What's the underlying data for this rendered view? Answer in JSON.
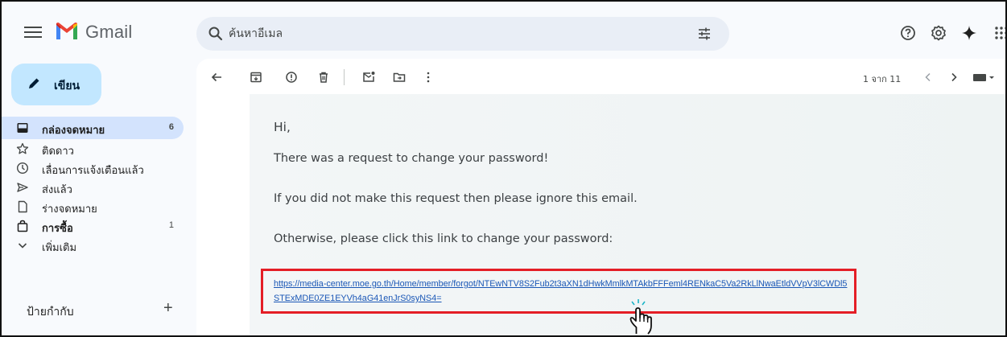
{
  "app": {
    "name": "Gmail"
  },
  "search": {
    "placeholder": "ค้นหาอีเมล"
  },
  "compose": {
    "label": "เขียน"
  },
  "sidebar": {
    "items": [
      {
        "label": "กล่องจดหมาย",
        "count": "6",
        "icon": "inbox-icon",
        "active": true,
        "bold": true
      },
      {
        "label": "ติดดาว",
        "count": "",
        "icon": "star-icon"
      },
      {
        "label": "เลื่อนการแจ้งเตือนแล้ว",
        "count": "",
        "icon": "clock-icon"
      },
      {
        "label": "ส่งแล้ว",
        "count": "",
        "icon": "send-icon"
      },
      {
        "label": "ร่างจดหมาย",
        "count": "",
        "icon": "draft-icon"
      },
      {
        "label": "การซื้อ",
        "count": "1",
        "icon": "shopping-bag-icon",
        "bold": true
      },
      {
        "label": "เพิ่มเติม",
        "count": "",
        "icon": "chevron-down-icon"
      }
    ],
    "labels_heading": "ป้ายกำกับ",
    "labels_add": "+"
  },
  "toolbar": {
    "pager": "1 จาก 11"
  },
  "email": {
    "greeting": "Hi,",
    "line1": "There was a request to change your password!",
    "line2": "If you did not make this request then please ignore this email.",
    "line3": "Otherwise, please click this link to change your password:",
    "link": "https://media-center.moe.go.th/Home/member/forgot/NTEwNTV8S2Fub2t3aXN1dHwkMmlkMTAkbFFFeml4RENkaC5Va2RkLlNwaEtldVVpV3lCWDl5STExMDE0ZE1EYVh4aG41enJrS0syNS4="
  },
  "colors": {
    "accent": "#c2e7ff",
    "active_nav": "#d3e3fd",
    "highlight_border": "#e41e26",
    "link": "#1a57b6"
  }
}
